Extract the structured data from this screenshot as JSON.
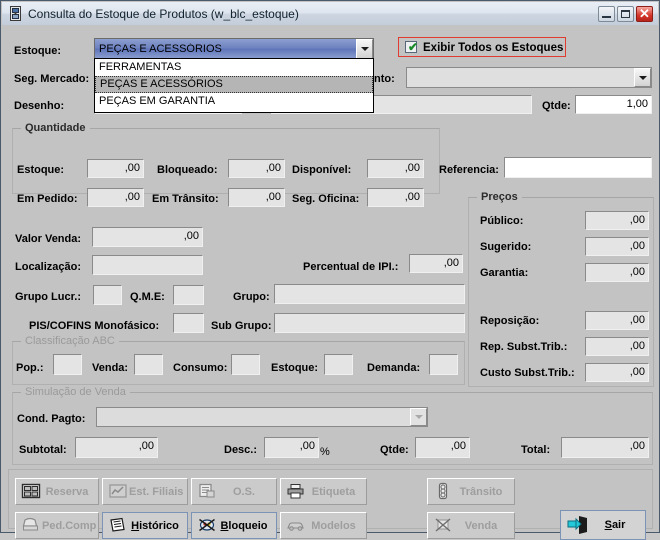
{
  "window": {
    "title": "Consulta do Estoque de Produtos (w_blc_estoque)",
    "icon": "app-window-icon",
    "buttons": {
      "minimize": "_",
      "maximize": "□",
      "close": "✕"
    }
  },
  "form": {
    "estoque_label": "Estoque:",
    "estoque_value": "PEÇAS E ACESSÓRIOS",
    "estoque_options": [
      "FERRAMENTAS",
      "PEÇAS E ACESSÓRIOS",
      "PEÇAS EM GARANTIA"
    ],
    "estoque_highlighted": "PEÇAS E ACESSÓRIOS",
    "exibir_todos_label": "Exibir Todos os Estoques",
    "exibir_todos_checked": true,
    "seg_mercado_label": "Seg. Mercado:",
    "seg_mercado_value": "",
    "departamento_label": "nto:",
    "departamento_value": "",
    "desenho_label": "Desenho:",
    "desenho_value": "",
    "qtde_label": "Qtde:",
    "qtde_value": "1,00",
    "referencia_label": "Referencia:",
    "referencia_value": ""
  },
  "quantidade": {
    "caption": "Quantidade",
    "fields": [
      {
        "label": "Estoque:",
        "value": ",00"
      },
      {
        "label": "Bloqueado:",
        "value": ",00"
      },
      {
        "label": "Disponível:",
        "value": ",00"
      },
      {
        "label": "Em Pedido:",
        "value": ",00"
      },
      {
        "label": "Em Trânsito:",
        "value": ",00"
      },
      {
        "label": "Seg. Oficina:",
        "value": ",00"
      }
    ]
  },
  "precos": {
    "caption": "Preços",
    "fields": [
      {
        "label": "Público:",
        "value": ",00"
      },
      {
        "label": "Sugerido:",
        "value": ",00"
      },
      {
        "label": "Garantia:",
        "value": ",00"
      },
      {
        "label": "Reposição:",
        "value": ",00"
      },
      {
        "label": "Rep. Subst.Trib.:",
        "value": ",00"
      },
      {
        "label": "Custo Subst.Trib.:",
        "value": ",00"
      }
    ]
  },
  "detalhes": {
    "valor_venda_label": "Valor Venda:",
    "valor_venda_value": ",00",
    "localizacao_label": "Localização:",
    "localizacao_value": "",
    "percentual_ipi_label": "Percentual de IPI.:",
    "percentual_ipi_value": ",00",
    "grupo_lucr_label": "Grupo Lucr.:",
    "grupo_lucr_value": "",
    "qme_label": "Q.M.E:",
    "qme_value": "",
    "grupo_label": "Grupo:",
    "grupo_value": "",
    "pis_cofins_label": "PIS/COFINS Monofásico:",
    "pis_cofins_value": "",
    "sub_grupo_label": "Sub Grupo:",
    "sub_grupo_value": ""
  },
  "classificacao_abc": {
    "caption": "Classificação ABC",
    "fields": [
      {
        "label": "Pop.:",
        "value": ""
      },
      {
        "label": "Venda:",
        "value": ""
      },
      {
        "label": "Consumo:",
        "value": ""
      },
      {
        "label": "Estoque:",
        "value": ""
      },
      {
        "label": "Demanda:",
        "value": ""
      }
    ]
  },
  "simulacao": {
    "caption": "Simulação de Venda",
    "cond_pagto_label": "Cond. Pagto:",
    "cond_pagto_value": "",
    "subtotal_label": "Subtotal:",
    "subtotal_value": ",00",
    "desc_label": "Desc.:",
    "desc_value": ",00",
    "desc_suffix": "%",
    "qtde_label": "Qtde:",
    "qtde_value": ",00",
    "total_label": "Total:",
    "total_value": ",00"
  },
  "toolbar": {
    "row1": [
      {
        "label": "Reserva",
        "icon": "reserve-icon",
        "enabled": false
      },
      {
        "label": "Est. Filiais",
        "icon": "branches-icon",
        "enabled": false
      },
      {
        "label": "O.S.",
        "icon": "service-order-icon",
        "enabled": false
      },
      {
        "label": "Etiqueta",
        "icon": "printer-icon",
        "enabled": false
      },
      {
        "label": "Trânsito",
        "icon": "traffic-light-icon",
        "enabled": false
      }
    ],
    "row2": [
      {
        "label": "Ped.Comp",
        "icon": "purchase-order-icon",
        "enabled": false
      },
      {
        "label": "Histórico",
        "icon": "history-icon",
        "enabled": true
      },
      {
        "label": "Bloqueio",
        "icon": "block-icon",
        "enabled": true
      },
      {
        "label": "Modelos",
        "icon": "car-icon",
        "enabled": false
      },
      {
        "label": "Venda",
        "icon": "sale-blocked-icon",
        "enabled": false
      }
    ],
    "exit": {
      "label": "Sair",
      "icon": "exit-door-icon"
    }
  },
  "colors": {
    "window_bg": "#c3c3c3",
    "field_bg": "#e4e4e4",
    "accent_selected": "#6d82c0",
    "highlight_red": "#e03b30",
    "check_green": "#1a8b2a"
  }
}
